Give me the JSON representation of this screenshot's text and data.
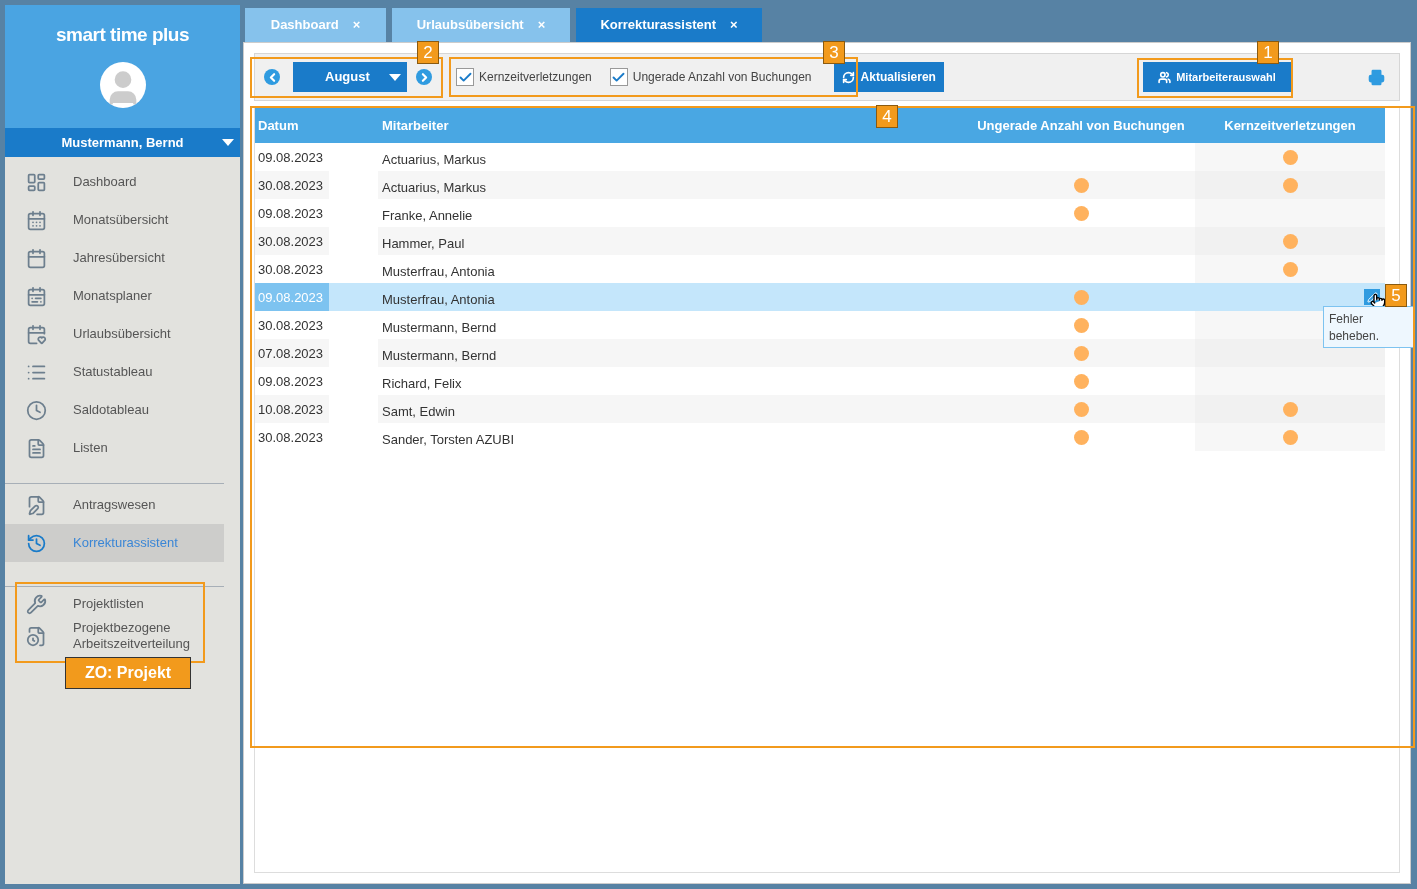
{
  "app": {
    "title": "smart time plus",
    "user": "Mustermann, Bernd"
  },
  "sidebar": {
    "groups": [
      {
        "items": [
          {
            "label": "Dashboard",
            "selected": false
          },
          {
            "label": "Monatsübersicht",
            "selected": false
          },
          {
            "label": "Jahresübersicht",
            "selected": false
          },
          {
            "label": "Monatsplaner",
            "selected": false
          },
          {
            "label": "Urlaubsübersicht",
            "selected": false
          },
          {
            "label": "Statustableau",
            "selected": false
          },
          {
            "label": "Saldotableau",
            "selected": false
          },
          {
            "label": "Listen",
            "selected": false
          }
        ]
      },
      {
        "items": [
          {
            "label": "Antragswesen",
            "selected": false
          },
          {
            "label": "Korrekturassistent",
            "selected": true
          }
        ]
      },
      {
        "items": [
          {
            "label": "Projektlisten",
            "selected": false
          },
          {
            "label": "Projektbezogene Arbeitszeitverteilung",
            "selected": false
          }
        ]
      }
    ]
  },
  "tabs": [
    {
      "label": "Dashboard",
      "close": "×",
      "selected": false
    },
    {
      "label": "Urlaubsübersicht",
      "close": "×",
      "selected": false
    },
    {
      "label": "Korrekturassistent",
      "close": "×",
      "selected": true
    }
  ],
  "toolbar": {
    "month": "August",
    "filters": [
      {
        "label": "Kernzeitverletzungen",
        "checked": true
      },
      {
        "label": "Ungerade Anzahl von Buchungen",
        "checked": true
      }
    ],
    "refresh": "Aktualisieren",
    "employee_select": "Mitarbeiterauswahl"
  },
  "table": {
    "columns": [
      "Datum",
      "Mitarbeiter",
      "Ungerade Anzahl von Buchungen",
      "Kernzeitverletzungen"
    ],
    "rows": [
      {
        "date": "09.08.2023",
        "employee": "Actuarius, Markus",
        "odd_bookings": false,
        "core_time_violation": true,
        "selected": false
      },
      {
        "date": "30.08.2023",
        "employee": "Actuarius, Markus",
        "odd_bookings": true,
        "core_time_violation": true,
        "selected": false
      },
      {
        "date": "09.08.2023",
        "employee": "Franke, Annelie",
        "odd_bookings": true,
        "core_time_violation": false,
        "selected": false
      },
      {
        "date": "30.08.2023",
        "employee": "Hammer, Paul",
        "odd_bookings": false,
        "core_time_violation": true,
        "selected": false
      },
      {
        "date": "30.08.2023",
        "employee": "Musterfrau, Antonia",
        "odd_bookings": false,
        "core_time_violation": true,
        "selected": false
      },
      {
        "date": "09.08.2023",
        "employee": "Musterfrau, Antonia",
        "odd_bookings": true,
        "core_time_violation": false,
        "selected": true
      },
      {
        "date": "30.08.2023",
        "employee": "Mustermann, Bernd",
        "odd_bookings": true,
        "core_time_violation": false,
        "selected": false
      },
      {
        "date": "07.08.2023",
        "employee": "Mustermann, Bernd",
        "odd_bookings": true,
        "core_time_violation": false,
        "selected": false
      },
      {
        "date": "09.08.2023",
        "employee": "Richard, Felix",
        "odd_bookings": true,
        "core_time_violation": false,
        "selected": false
      },
      {
        "date": "10.08.2023",
        "employee": "Samt, Edwin",
        "odd_bookings": true,
        "core_time_violation": true,
        "selected": false
      },
      {
        "date": "30.08.2023",
        "employee": "Sander, Torsten AZUBI",
        "odd_bookings": true,
        "core_time_violation": true,
        "selected": false
      }
    ]
  },
  "tooltip": "Fehler beheben.",
  "callouts": [
    {
      "label": "2"
    },
    {
      "label": "3"
    },
    {
      "label": "1"
    },
    {
      "label": "4"
    },
    {
      "label": "5"
    },
    {
      "label": "ZO: Projekt"
    }
  ]
}
